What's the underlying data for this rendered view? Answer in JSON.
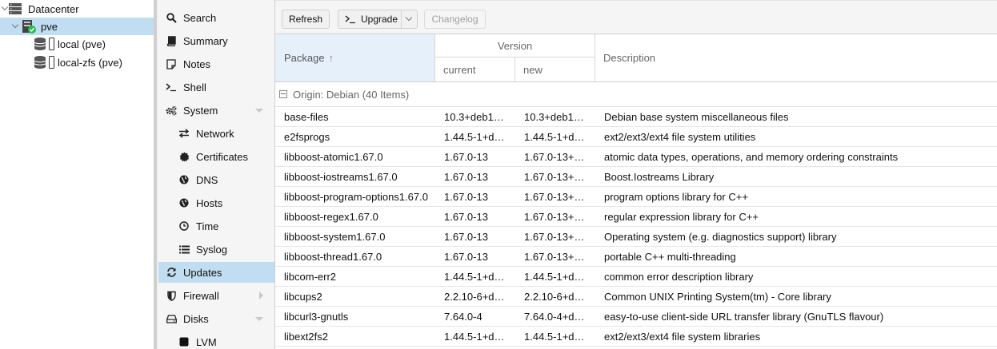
{
  "tree": {
    "items": [
      {
        "label": "Datacenter",
        "icon": "datacenter-icon"
      },
      {
        "label": "pve",
        "icon": "node-online-icon"
      },
      {
        "label": "local (pve)",
        "icon": "storage-icon"
      },
      {
        "label": "local-zfs (pve)",
        "icon": "storage-icon"
      }
    ]
  },
  "menu": {
    "items": [
      {
        "label": "Search",
        "icon": "search-icon"
      },
      {
        "label": "Summary",
        "icon": "book-icon"
      },
      {
        "label": "Notes",
        "icon": "notes-icon"
      },
      {
        "label": "Shell",
        "icon": "terminal-icon"
      },
      {
        "label": "System",
        "icon": "gears-icon"
      },
      {
        "label": "Network",
        "icon": "exchange-icon"
      },
      {
        "label": "Certificates",
        "icon": "certificate-icon"
      },
      {
        "label": "DNS",
        "icon": "globe-icon"
      },
      {
        "label": "Hosts",
        "icon": "globe-icon"
      },
      {
        "label": "Time",
        "icon": "clock-icon"
      },
      {
        "label": "Syslog",
        "icon": "list-icon"
      },
      {
        "label": "Updates",
        "icon": "refresh-icon"
      },
      {
        "label": "Firewall",
        "icon": "shield-icon"
      },
      {
        "label": "Disks",
        "icon": "hdd-icon"
      },
      {
        "label": "LVM",
        "icon": "square-icon"
      }
    ],
    "active": "Updates"
  },
  "toolbar": {
    "refresh_label": "Refresh",
    "upgrade_label": "Upgrade",
    "upgrade_icon": "terminal-icon",
    "changelog_label": "Changelog"
  },
  "grid": {
    "headers": {
      "package": "Package",
      "version": "Version",
      "current": "current",
      "new": "new",
      "description": "Description"
    },
    "group_label": "Origin: Debian (40 Items)",
    "rows": [
      {
        "package": "base-files",
        "current": "10.3+deb1…",
        "new": "10.3+deb1…",
        "description": "Debian base system miscellaneous files"
      },
      {
        "package": "e2fsprogs",
        "current": "1.44.5-1+d…",
        "new": "1.44.5-1+d…",
        "description": "ext2/ext3/ext4 file system utilities"
      },
      {
        "package": "libboost-atomic1.67.0",
        "current": "1.67.0-13",
        "new": "1.67.0-13+…",
        "description": "atomic data types, operations, and memory ordering constraints"
      },
      {
        "package": "libboost-iostreams1.67.0",
        "current": "1.67.0-13",
        "new": "1.67.0-13+…",
        "description": "Boost.Iostreams Library"
      },
      {
        "package": "libboost-program-options1.67.0",
        "current": "1.67.0-13",
        "new": "1.67.0-13+…",
        "description": "program options library for C++"
      },
      {
        "package": "libboost-regex1.67.0",
        "current": "1.67.0-13",
        "new": "1.67.0-13+…",
        "description": "regular expression library for C++"
      },
      {
        "package": "libboost-system1.67.0",
        "current": "1.67.0-13",
        "new": "1.67.0-13+…",
        "description": "Operating system (e.g. diagnostics support) library"
      },
      {
        "package": "libboost-thread1.67.0",
        "current": "1.67.0-13",
        "new": "1.67.0-13+…",
        "description": "portable C++ multi-threading"
      },
      {
        "package": "libcom-err2",
        "current": "1.44.5-1+d…",
        "new": "1.44.5-1+d…",
        "description": "common error description library"
      },
      {
        "package": "libcups2",
        "current": "2.2.10-6+d…",
        "new": "2.2.10-6+d…",
        "description": "Common UNIX Printing System(tm) - Core library"
      },
      {
        "package": "libcurl3-gnutls",
        "current": "7.64.0-4",
        "new": "7.64.0-4+d…",
        "description": "easy-to-use client-side URL transfer library (GnuTLS flavour)"
      },
      {
        "package": "libext2fs2",
        "current": "1.44.5-1+d…",
        "new": "1.44.5-1+d…",
        "description": "ext2/ext3/ext4 file system libraries"
      }
    ]
  },
  "colors": {
    "selection": "#c1ddf1",
    "header_sorted": "#e6f0fa",
    "node_online": "#21bf4b"
  }
}
